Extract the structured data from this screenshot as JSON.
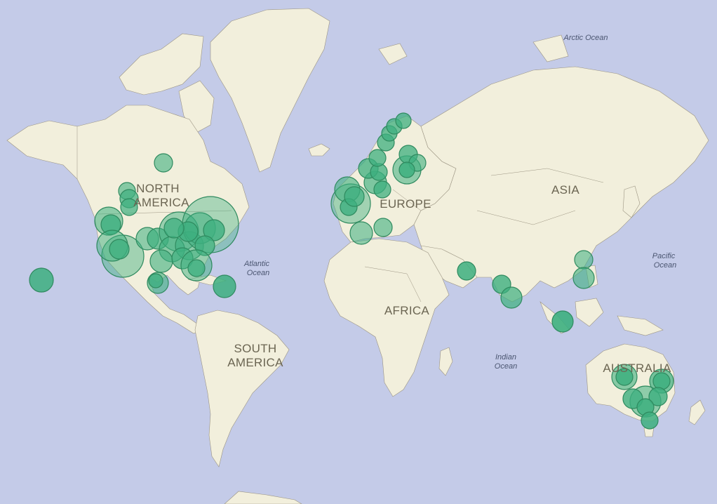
{
  "map": {
    "colors": {
      "ocean": "#c4cbe8",
      "land": "#f2efdc",
      "border": "#9b9482",
      "bubble_fill": "#3daf7f",
      "bubble_stroke": "#2f8a5f",
      "label": "#6b6552"
    },
    "continent_labels": {
      "north_america_1": "NORTH",
      "north_america_2": "AMERICA",
      "south_america_1": "SOUTH",
      "south_america_2": "AMERICA",
      "europe": "EUROPE",
      "asia": "ASIA",
      "africa": "AFRICA",
      "australia": "AUSTRALIA"
    },
    "ocean_labels": {
      "arctic": "Arctic Ocean",
      "atlantic_1": "Atlantic",
      "atlantic_2": "Ocean",
      "pacific_1": "Pacific",
      "pacific_2": "Ocean",
      "indian_1": "Indian",
      "indian_2": "Ocean"
    }
  }
}
